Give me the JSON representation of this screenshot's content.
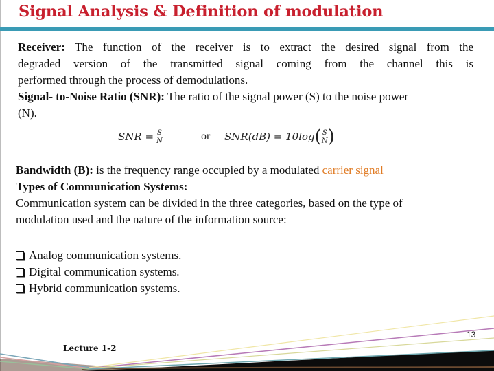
{
  "slide": {
    "title": "Signal Analysis & Definition of modulation",
    "receiver": {
      "term": "Receiver:",
      "line1": " The function of the receiver is to extract the desired signal from the",
      "line2": "degraded version of the transmitted signal coming from the channel this is",
      "line3": "performed through the process of demodulations."
    },
    "snr": {
      "term": "Signal- to-Noise Ratio (SNR):",
      "line1": " The ratio of the signal power (S) to the noise power",
      "line2": "(N)."
    },
    "formula": {
      "lhs1": "SNR =",
      "num": "S",
      "den": "N",
      "or": "or",
      "lhs2": "SNR(dB) = 10log",
      "open": "(",
      "close": ")"
    },
    "bandwidth": {
      "term": "Bandwidth (B):",
      "text": " is the frequency range occupied by a modulated ",
      "link": "carrier signal"
    },
    "types": {
      "heading": "Types of Communication Systems:",
      "line1": "Communication system can be divided in the three categories, based on the type of",
      "line2": "modulation used and the nature of the information source:"
    },
    "list": [
      "Analog communication systems.",
      "Digital communication systems.",
      "Hybrid communication systems."
    ],
    "page_number": "13",
    "footer": "Lecture 1-2",
    "colors": {
      "title": "#c8202e",
      "rule": "#3a9bb5",
      "link": "#e07b24"
    }
  }
}
